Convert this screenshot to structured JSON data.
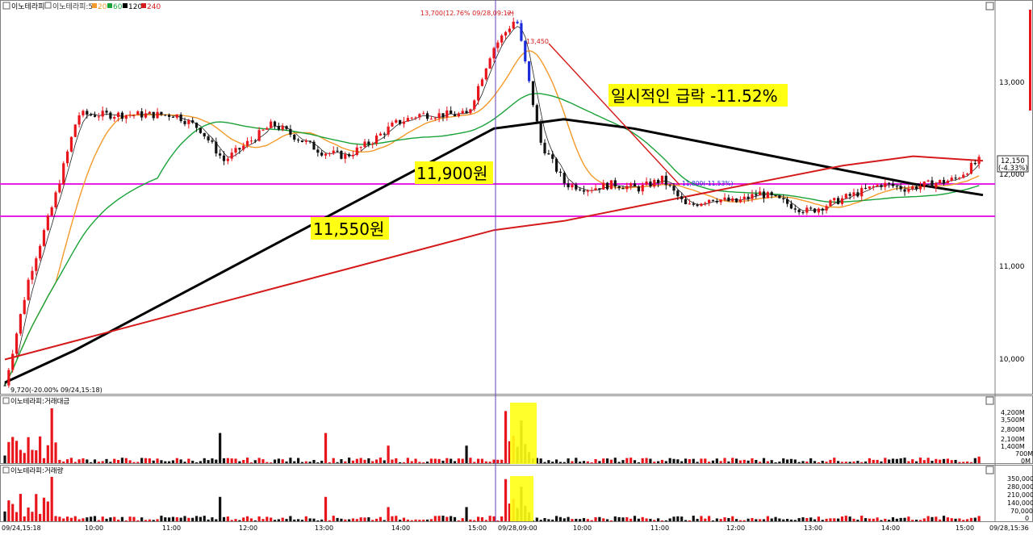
{
  "colors": {
    "up": "#e8161c",
    "down": "#111111",
    "down_blue": "#1a2bd8",
    "ma5": "#222222",
    "ma20": "#f39a2a",
    "ma60": "#1aa33a",
    "ma120": "#000000",
    "ma240": "#d41a1a",
    "hline": "#e61ee6",
    "highlight": "#ffff14"
  },
  "main_panel": {
    "title": "이노테라피",
    "legend": [
      {
        "label": "이노테라피:5",
        "color": "#333333"
      },
      {
        "label": "20",
        "color": "#f39a2a"
      },
      {
        "label": "60",
        "color": "#1aa33a"
      },
      {
        "label": "120",
        "color": "#000000"
      },
      {
        "label": "240",
        "color": "#d41a1a"
      }
    ],
    "y_ticks": [
      "13,000",
      "12,000",
      "11,000",
      "10,000"
    ],
    "current_price": "12,150",
    "current_change": "(-4.33%)",
    "high_label": "13,700(12.76% 09/28,09:12)",
    "low_label": "9,720(-20.00% 09/24,15:18)",
    "line_label": "13,450",
    "mid_label": "11,800(-11.53%)",
    "annotations": {
      "drop": "일시적인 급락 -11.52%",
      "level1": "11,900원",
      "level2": "11,550원"
    }
  },
  "amount_panel": {
    "title": "이노테라피:거래대금",
    "y_ticks": [
      "4,200M",
      "3,500M",
      "2,800M",
      "2,100M",
      "1,400M",
      "700M",
      "0M"
    ]
  },
  "volume_panel": {
    "title": "이노테라피:거래량",
    "y_ticks": [
      "350,000",
      "280,000",
      "210,000",
      "140,000",
      "70,000",
      "0"
    ]
  },
  "x_axis": {
    "start_label": "09/24,15:18",
    "end_label": "09/28,15:36",
    "ticks": [
      "10:00",
      "11:00",
      "12:00",
      "13:00",
      "14:00",
      "15:00",
      "09/28,09:00",
      "10:00",
      "11:00",
      "12:00",
      "13:00",
      "14:00",
      "15:00"
    ]
  },
  "chart_data": {
    "type": "candlestick",
    "interval": "5-minute",
    "ylim": [
      9700,
      13800
    ],
    "high": {
      "value": 13700,
      "change_pct": 12.76,
      "time": "09/28,09:12"
    },
    "low": {
      "value": 9720,
      "change_pct": -20.0,
      "time": "09/24,15:18"
    },
    "last": {
      "value": 12150,
      "change_pct": -4.33
    },
    "horizontal_lines": [
      11900,
      11550
    ],
    "price_path": [
      9720,
      10900,
      11700,
      12650,
      12650,
      12650,
      12650,
      12650,
      12500,
      12150,
      12350,
      12550,
      12400,
      12250,
      12200,
      12350,
      12550,
      12650,
      12650,
      12650,
      13350,
      13700,
      12350,
      11900,
      11850,
      11900,
      11850,
      11950,
      11650,
      11750,
      11700,
      11800,
      11700,
      11600,
      11700,
      11800,
      11900,
      11850,
      11900,
      11950,
      12150
    ],
    "ma120_path": [
      9750,
      10100,
      10500,
      10900,
      11300,
      11700,
      12100,
      12500,
      12600,
      12500,
      12350,
      12200,
      12050,
      11900,
      11780
    ],
    "ma240_path": [
      10000,
      10200,
      10400,
      10600,
      10800,
      11000,
      11200,
      11400,
      11500,
      11650,
      11800,
      11950,
      12100,
      12200,
      12150
    ],
    "volume_amount_max": 4200,
    "volume_max": 350000
  }
}
